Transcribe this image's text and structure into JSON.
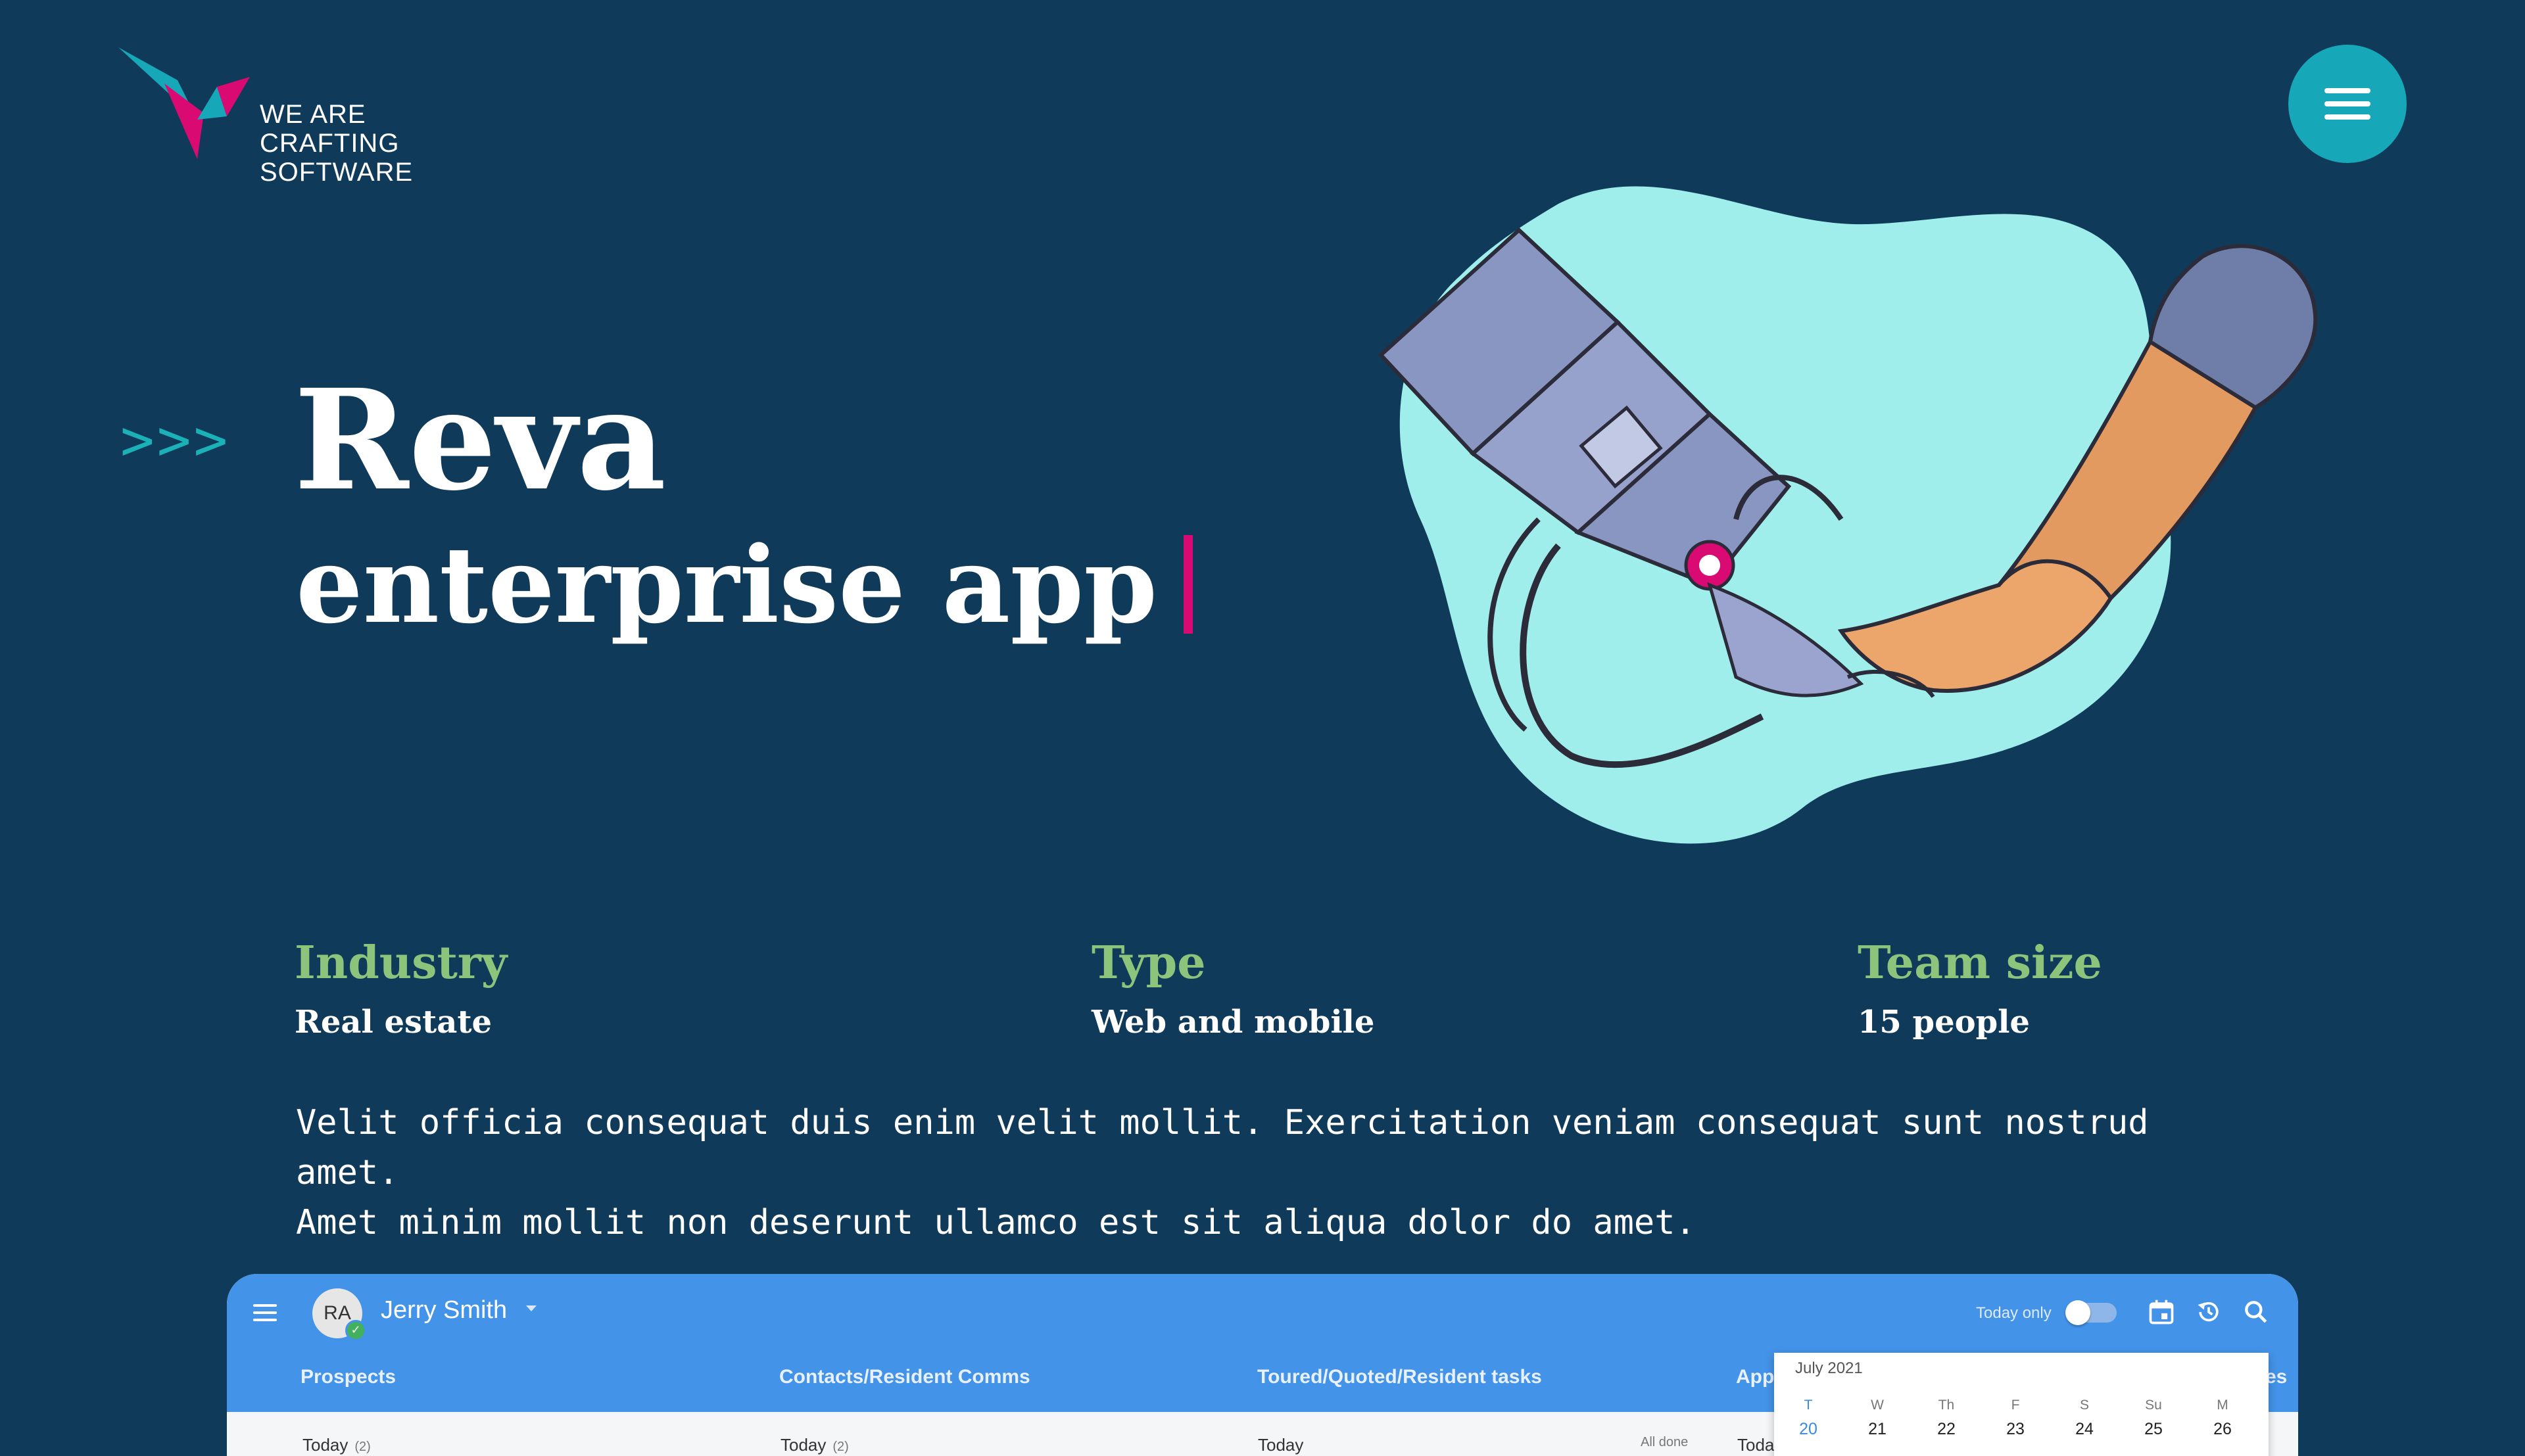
{
  "brand": {
    "logo_line1": "WE ARE",
    "logo_line2": "CRAFTING SOFTWARE"
  },
  "hero": {
    "arrows": ">>>",
    "title": "Reva",
    "subtitle": "enterprise app"
  },
  "facts": [
    {
      "label": "Industry",
      "value": "Real estate"
    },
    {
      "label": "Type",
      "value": "Web and mobile"
    },
    {
      "label": "Team size",
      "value": "15 people"
    }
  ],
  "description": {
    "line1": "Velit officia consequat duis enim velit mollit. Exercitation veniam consequat sunt nostrud amet.",
    "line2": "Amet minim mollit non deserunt ullamco est sit aliqua dolor do amet."
  },
  "app": {
    "avatar_initials": "RA",
    "user_name": "Jerry Smith",
    "today_only_label": "Today only",
    "today_only_on": false,
    "tabs": [
      "Prospects",
      "Contacts/Resident Comms",
      "Toured/Quoted/Resident tasks",
      "App",
      "es"
    ],
    "columns": [
      {
        "label": "Today",
        "count": "(2)"
      },
      {
        "label": "Today",
        "count": "(2)"
      },
      {
        "label": "Today",
        "count": ""
      },
      {
        "label": "All done",
        "count": ""
      },
      {
        "label": "Toda",
        "count": ""
      }
    ],
    "calendar": {
      "month": "July 2021",
      "days": [
        {
          "name": "T",
          "date": "20",
          "today": true
        },
        {
          "name": "W",
          "date": "21"
        },
        {
          "name": "Th",
          "date": "22"
        },
        {
          "name": "F",
          "date": "23"
        },
        {
          "name": "S",
          "date": "24"
        },
        {
          "name": "Su",
          "date": "25"
        },
        {
          "name": "M",
          "date": "26"
        }
      ]
    }
  },
  "colors": {
    "background": "#103a59",
    "accent_teal": "#16a8b8",
    "accent_magenta": "#d90a72",
    "fact_label_green": "#8cc47c",
    "app_bar_blue": "#4393e8"
  },
  "icons": [
    "logo-mark-icon",
    "menu-icon",
    "hamburger-icon",
    "calendar-icon",
    "history-icon",
    "search-icon",
    "check-icon",
    "caret-down-icon"
  ]
}
